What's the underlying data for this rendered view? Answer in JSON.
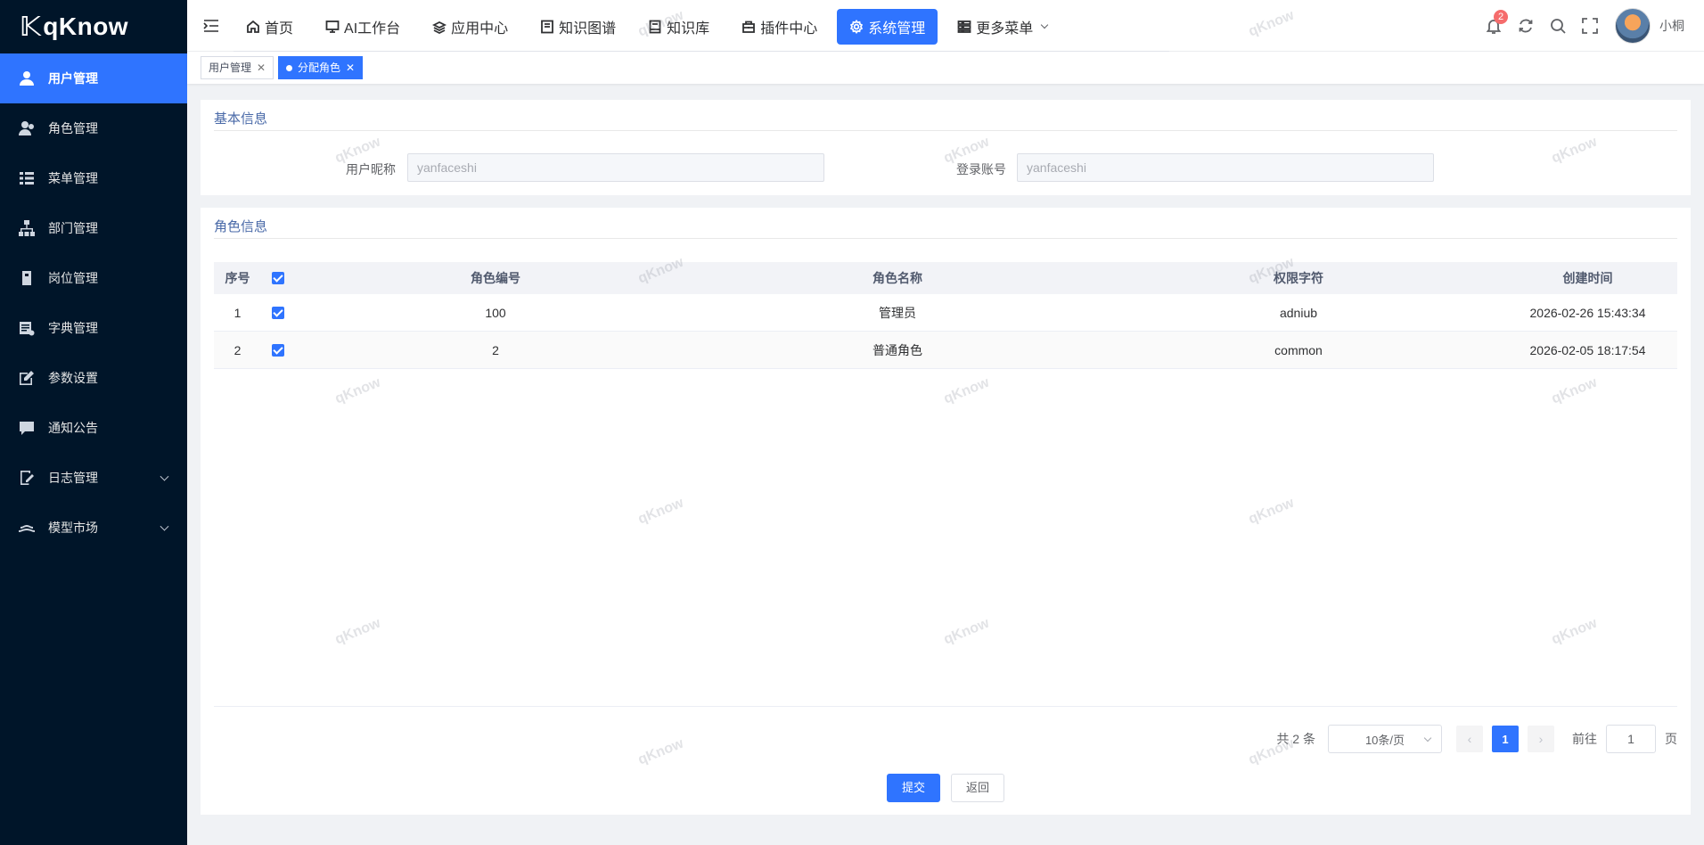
{
  "brand": {
    "name": "qKnow"
  },
  "sidebar": {
    "items": [
      {
        "label": "用户管理",
        "icon": "user-icon",
        "active": true
      },
      {
        "label": "角色管理",
        "icon": "role-icon"
      },
      {
        "label": "菜单管理",
        "icon": "menu-tree-icon"
      },
      {
        "label": "部门管理",
        "icon": "org-tree-icon"
      },
      {
        "label": "岗位管理",
        "icon": "post-icon"
      },
      {
        "label": "字典管理",
        "icon": "dictionary-icon"
      },
      {
        "label": "参数设置",
        "icon": "edit-icon"
      },
      {
        "label": "通知公告",
        "icon": "message-icon"
      },
      {
        "label": "日志管理",
        "icon": "log-icon",
        "expandable": true
      },
      {
        "label": "模型市场",
        "icon": "model-market-icon",
        "expandable": true
      }
    ]
  },
  "topnav": {
    "items": [
      {
        "label": "首页",
        "icon": "home-icon"
      },
      {
        "label": "AI工作台",
        "icon": "monitor-icon"
      },
      {
        "label": "应用中心",
        "icon": "app-icon"
      },
      {
        "label": "知识图谱",
        "icon": "graph-icon"
      },
      {
        "label": "知识库",
        "icon": "book-icon"
      },
      {
        "label": "插件中心",
        "icon": "plugin-icon"
      },
      {
        "label": "系统管理",
        "icon": "gear-icon",
        "active": true
      },
      {
        "label": "更多菜单",
        "icon": "more-icon",
        "dropdown": true
      }
    ]
  },
  "header": {
    "notification_count": "2",
    "username": "小桐"
  },
  "tags": [
    {
      "label": "用户管理",
      "active": false
    },
    {
      "label": "分配角色",
      "active": true
    }
  ],
  "basic_info": {
    "title": "基本信息",
    "nickname_label": "用户昵称",
    "nickname_value": "yanfaceshi",
    "account_label": "登录账号",
    "account_value": "yanfaceshi"
  },
  "role_info": {
    "title": "角色信息",
    "columns": {
      "index": "序号",
      "code": "角色编号",
      "name": "角色名称",
      "key": "权限字符",
      "created": "创建时间"
    },
    "rows": [
      {
        "index": "1",
        "code": "100",
        "name": "管理员",
        "key": "adniub",
        "created": "2026-02-26 15:43:34",
        "checked": true
      },
      {
        "index": "2",
        "code": "2",
        "name": "普通角色",
        "key": "common",
        "created": "2026-02-05 18:17:54",
        "checked": true
      }
    ]
  },
  "pagination": {
    "total": "共 2 条",
    "page_size": "10条/页",
    "prev": "‹",
    "current": "1",
    "next": "›",
    "goto_label": "前往",
    "goto_value": "1",
    "page_suffix": "页"
  },
  "actions": {
    "submit": "提交",
    "back": "返回"
  },
  "watermark": "qKnow",
  "colors": {
    "primary": "#2f74ff",
    "sidebar": "#001529",
    "badge": "#f56c6c"
  }
}
